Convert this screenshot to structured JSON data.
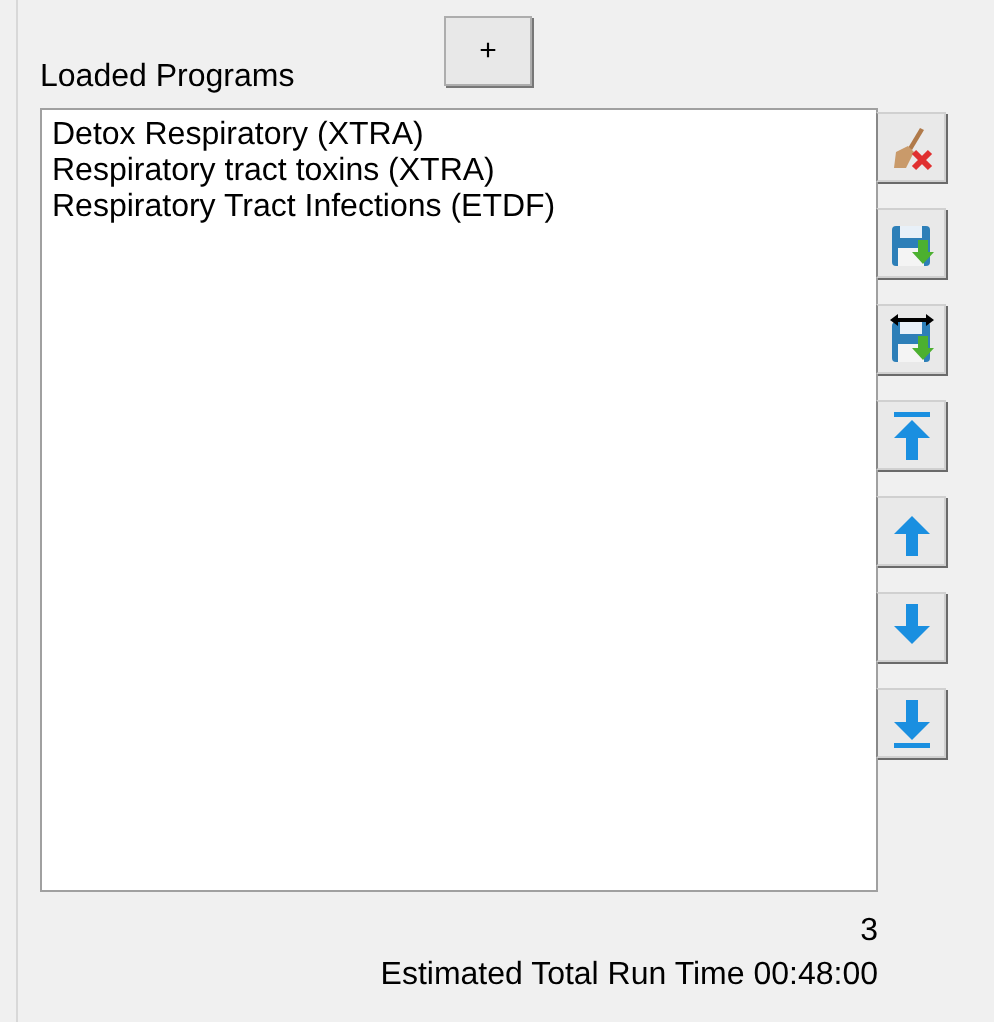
{
  "header": {
    "label": "Loaded Programs",
    "add_button": "+"
  },
  "programs": [
    {
      "name": "Detox Respiratory (XTRA)",
      "selected": false
    },
    {
      "name": "Respiratory tract toxins (XTRA)",
      "selected": false
    },
    {
      "name": "Respiratory Tract Infections (ETDF)",
      "selected": false
    }
  ],
  "tool_buttons": [
    {
      "kind": "clear"
    },
    {
      "kind": "save"
    },
    {
      "kind": "save_as"
    },
    {
      "kind": "top"
    },
    {
      "kind": "up"
    },
    {
      "kind": "down"
    },
    {
      "kind": "bottom"
    }
  ],
  "footer": {
    "count": "3",
    "run_time": "Estimated Total Run Time 00:48:00"
  }
}
